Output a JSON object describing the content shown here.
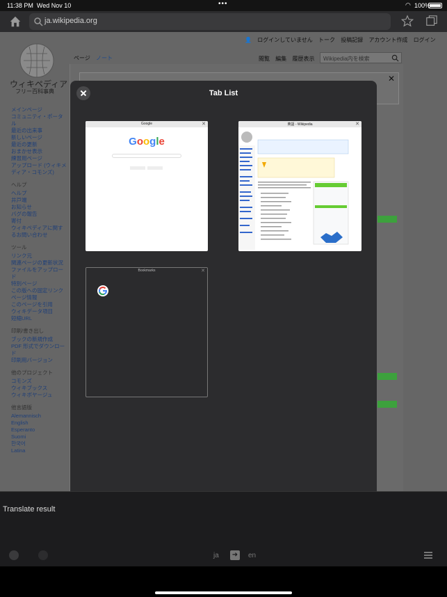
{
  "status_bar": {
    "time": "11:38 PM",
    "date": "Wed Nov 10",
    "battery": "100%"
  },
  "toolbar": {
    "url": "ja.wikipedia.org"
  },
  "wiki": {
    "logo_title": "ウィキペディア",
    "logo_subtitle": "フリー百科事典",
    "top_links": [
      "ログインしていません",
      "トーク",
      "投稿記録",
      "アカウント作成",
      "ログイン"
    ],
    "tab_page": "ページ",
    "tab_note": "ノート",
    "tabs_right": [
      "閲覧",
      "編集",
      "履歴表示"
    ],
    "search_placeholder": "Wikipedia内を検索",
    "sidebar": {
      "main": [
        "メインページ",
        "コミュニティ・ポータル",
        "最近の出来事",
        "新しいページ",
        "最近の更新",
        "おまかせ表示",
        "練習用ページ",
        "アップロード (ウィキメディア・コモンズ)"
      ],
      "help_heading": "ヘルプ",
      "help": [
        "ヘルプ",
        "井戸端",
        "お知らせ",
        "バグの報告",
        "寄付",
        "ウィキペディアに関するお問い合わせ"
      ],
      "tools_heading": "ツール",
      "tools": [
        "リンク元",
        "関連ページの更新状況",
        "ファイルをアップロード",
        "特別ページ",
        "この版への固定リンク",
        "ページ情報",
        "このページを引用",
        "ウィキデータ項目",
        "短縮URL"
      ],
      "print_heading": "印刷/書き出し",
      "print": [
        "ブックの新規作成",
        "PDF 形式でダウンロード",
        "印刷用バージョン"
      ],
      "other_heading": "他のプロジェクト",
      "other": [
        "コモンズ",
        "ウィキブックス",
        "ウィキボヤージュ"
      ],
      "lang_heading": "他言語版",
      "langs": [
        "Alemannisch",
        "English",
        "Esperanto",
        "Suomi",
        "한국어",
        "Latina"
      ]
    }
  },
  "modal": {
    "title": "Tab List",
    "tabs": [
      {
        "title": "Google"
      },
      {
        "title": "英語 - Wikipedia"
      },
      {
        "title": "Bookmarks"
      }
    ],
    "google_logo": [
      "G",
      "o",
      "o",
      "g",
      "l",
      "e"
    ]
  },
  "translate": {
    "label": "Translate result",
    "source_lang": "ja",
    "target_lang": "en"
  }
}
